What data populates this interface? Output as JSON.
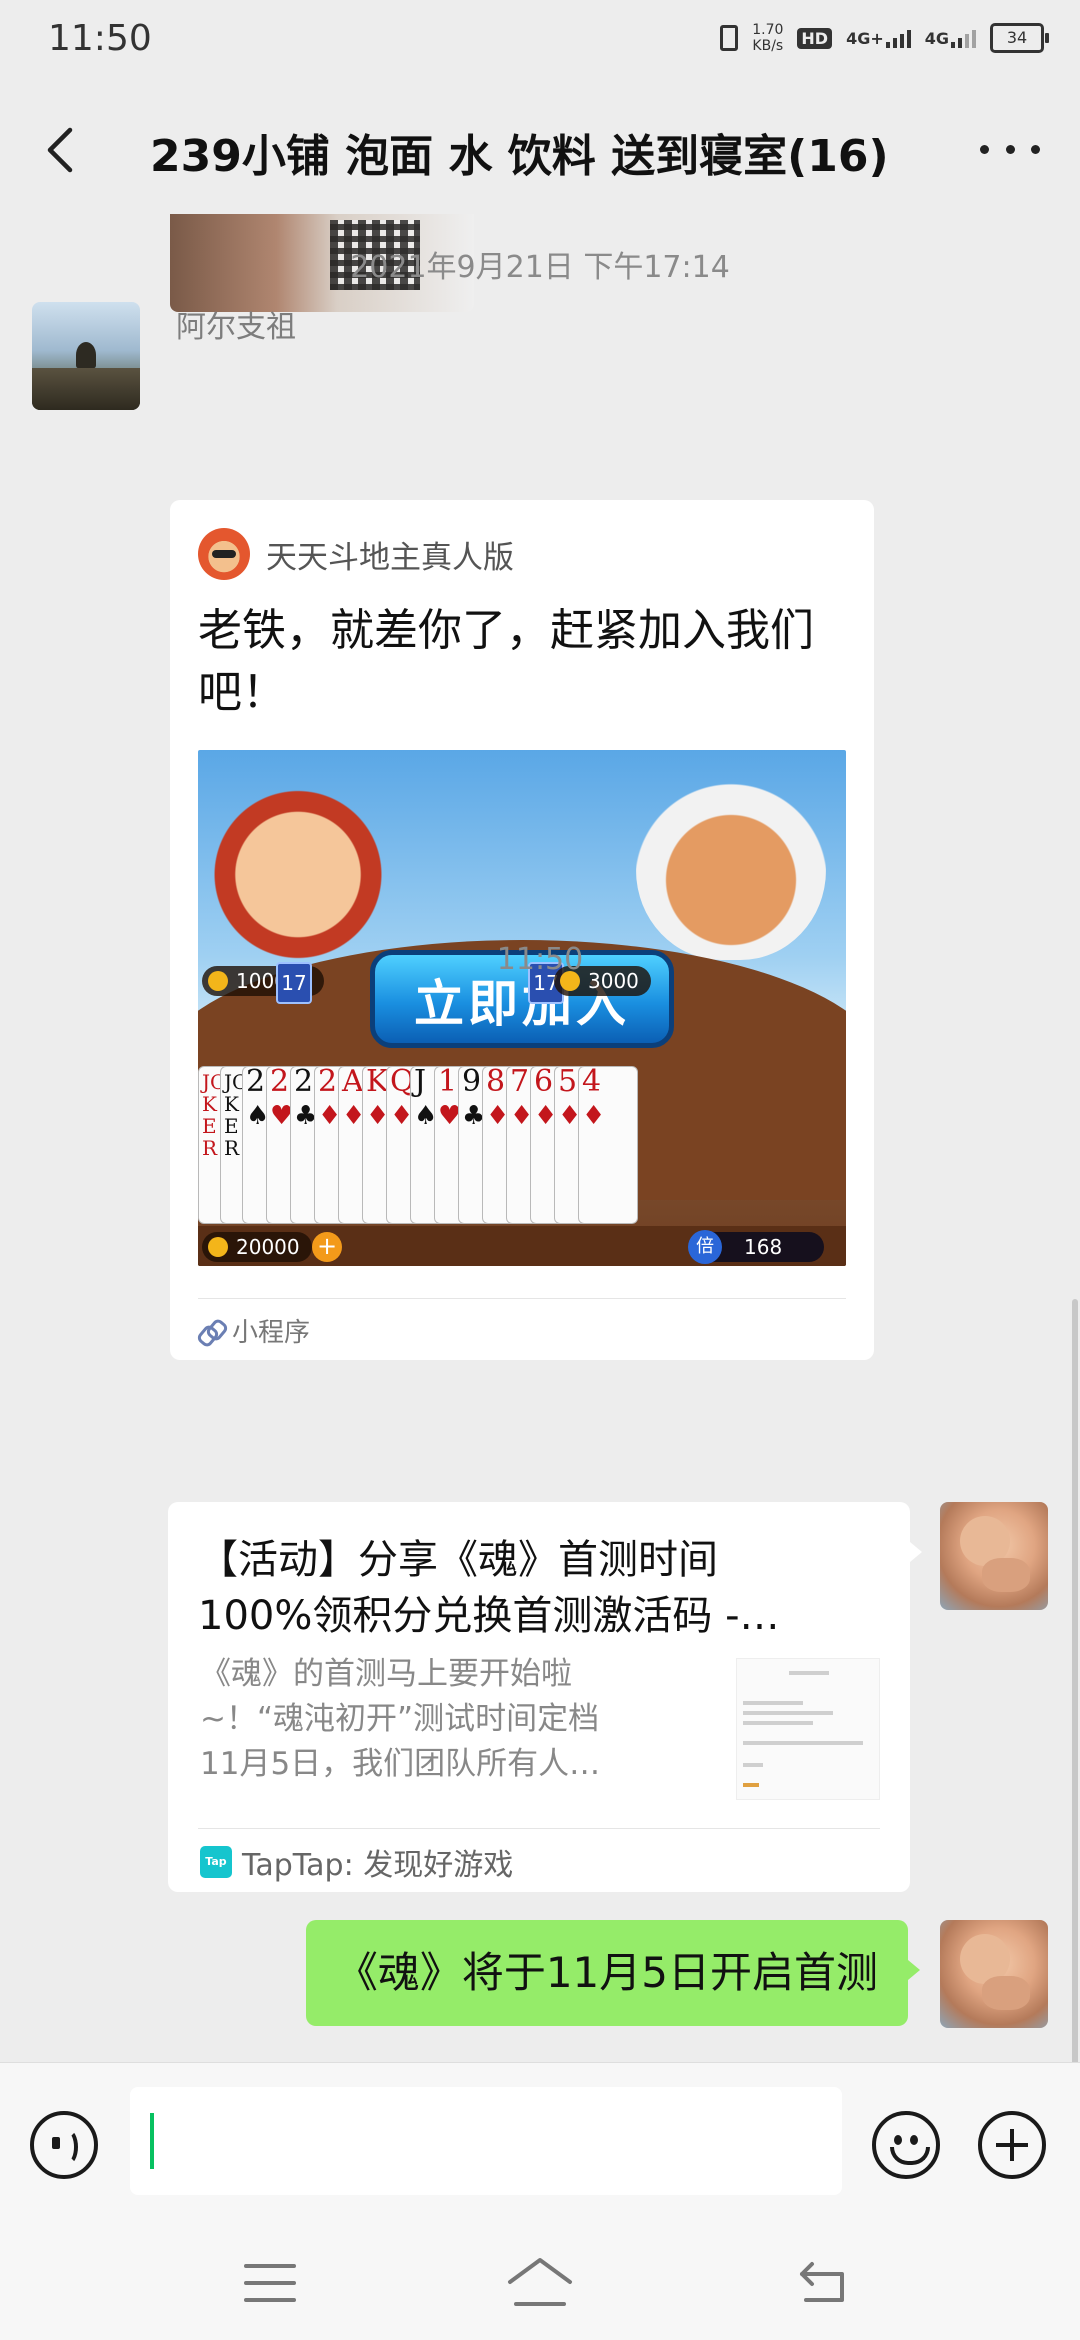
{
  "status_bar": {
    "time": "11:50",
    "net_speed_value": "1.70",
    "net_speed_unit": "KB/s",
    "hd_label": "HD",
    "sim1_label": "4G+",
    "sim2_label": "4G",
    "battery": "34"
  },
  "header": {
    "title": "239小铺  泡面  水 饮料  送到寝室(16)"
  },
  "messages": {
    "timestamp_1": "2021年9月21日 下午17:14",
    "sender_1": "阿尔支祖",
    "mini_program": {
      "app_name": "天天斗地主真人版",
      "title": "老铁，就差你了，赶紧加入我们吧！",
      "join_button": "立即加入",
      "left_coins": "100000",
      "left_count": "17",
      "right_coins": "3000",
      "right_count": "17",
      "my_coins": "20000",
      "plus": "+",
      "multiplier_label": "倍",
      "multiplier_value": "168",
      "cards": [
        {
          "rank": "JOKER",
          "suit": "",
          "color": "red",
          "joker": true
        },
        {
          "rank": "JOKER",
          "suit": "",
          "color": "black",
          "joker": true
        },
        {
          "rank": "2",
          "suit": "♠",
          "color": "black"
        },
        {
          "rank": "2",
          "suit": "♥",
          "color": "red"
        },
        {
          "rank": "2",
          "suit": "♣",
          "color": "black"
        },
        {
          "rank": "2",
          "suit": "♦",
          "color": "red"
        },
        {
          "rank": "A",
          "suit": "♦",
          "color": "red"
        },
        {
          "rank": "K",
          "suit": "♦",
          "color": "red"
        },
        {
          "rank": "Q",
          "suit": "♦",
          "color": "red"
        },
        {
          "rank": "J",
          "suit": "♠",
          "color": "black"
        },
        {
          "rank": "10",
          "suit": "♥",
          "color": "red"
        },
        {
          "rank": "9",
          "suit": "♣",
          "color": "black"
        },
        {
          "rank": "8",
          "suit": "♦",
          "color": "red"
        },
        {
          "rank": "7",
          "suit": "♦",
          "color": "red"
        },
        {
          "rank": "6",
          "suit": "♦",
          "color": "red"
        },
        {
          "rank": "5",
          "suit": "♦",
          "color": "red"
        },
        {
          "rank": "4",
          "suit": "♦",
          "color": "red"
        }
      ],
      "footer": "小程序"
    },
    "timestamp_2": "11:50",
    "article": {
      "title_line1": "【活动】分享《魂》首测时间",
      "title_line2": "100%领积分兑换首测激活码 -…",
      "desc_line1": "《魂》的首测马上要开始啦",
      "desc_line2": "~！“魂沌初开”测试时间定档",
      "desc_line3": "11月5日，我们团队所有人…",
      "source_icon_text": "Tap",
      "source": "TapTap: 发现好游戏"
    },
    "my_text": "《魂》将于11月5日开启首测"
  },
  "input_bar": {
    "value": "",
    "placeholder": ""
  },
  "colors": {
    "accent": "#07c160",
    "my_bubble": "#95ec69",
    "background": "#ededed"
  },
  "icons": [
    "back-icon",
    "more-icon",
    "voice-icon",
    "emoji-icon",
    "plus-icon",
    "link-icon",
    "menu-icon",
    "home-icon",
    "nav-back-icon"
  ]
}
